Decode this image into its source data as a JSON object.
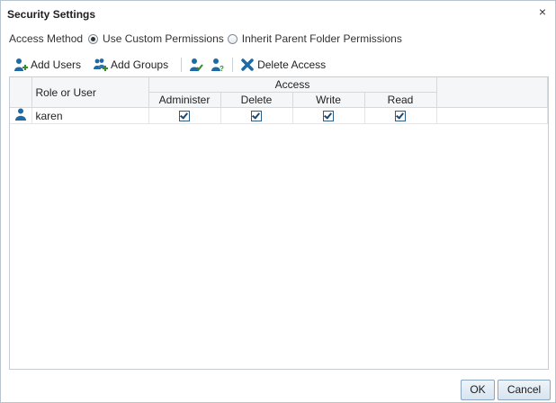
{
  "dialog": {
    "title": "Security Settings",
    "close_glyph": "×"
  },
  "access_method": {
    "label": "Access Method",
    "options": [
      {
        "label": "Use Custom Permissions",
        "selected": true
      },
      {
        "label": "Inherit Parent Folder Permissions",
        "selected": false
      }
    ]
  },
  "toolbar": {
    "add_users": "Add Users",
    "add_groups": "Add Groups",
    "delete_access": "Delete Access"
  },
  "table": {
    "role_header": "Role or User",
    "access_header": "Access",
    "columns": [
      "Administer",
      "Delete",
      "Write",
      "Read"
    ],
    "rows": [
      {
        "name": "karen",
        "icon": "user-icon",
        "administer": true,
        "delete": true,
        "write": true,
        "read": true
      }
    ]
  },
  "buttons": {
    "ok": "OK",
    "cancel": "Cancel"
  },
  "colors": {
    "accent": "#1f6aa5",
    "header_bg": "#f4f6f8",
    "button_bg": "#d7e4f0"
  }
}
